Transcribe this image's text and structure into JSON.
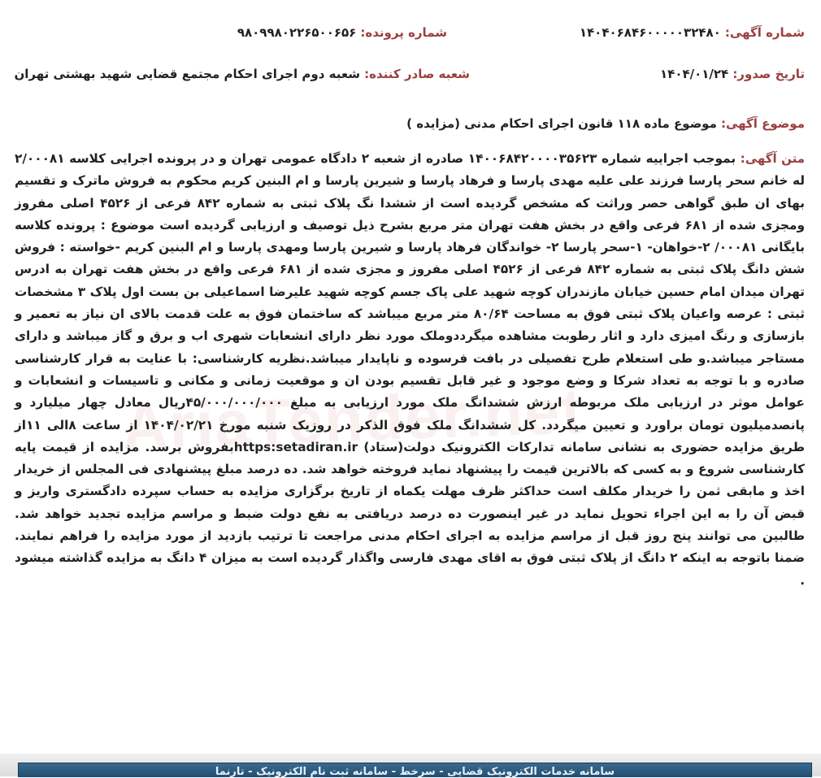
{
  "header": {
    "notice_number_label": "شماره آگهی:",
    "notice_number_value": "۱۴۰۴۰۶۸۴۶۰۰۰۰۰۳۲۴۸۰",
    "case_number_label": "شماره پرونده:",
    "case_number_value": "۹۸۰۹۹۸۰۲۲۶۵۰۰۶۵۶",
    "issue_date_label": "تاریخ صدور:",
    "issue_date_value": "۱۴۰۴/۰۱/۲۴",
    "issuer_label": "شعبه صادر کننده:",
    "issuer_value": "شعبه دوم اجرای احکام مجتمع قضایی شهید بهشتی تهران",
    "subject_label": "موضوع آگهی:",
    "subject_value": "موضوع ماده ۱۱۸ قانون اجرای احکام مدنی (مزایده )"
  },
  "body": {
    "label": "متن آگهی:",
    "text": "بموجب اجراییه شماره ۱۴۰۰۶۸۴۲۰۰۰۰۳۵۶۲۳ صادره از شعبه ۲ دادگاه عمومی تهران و در پرونده اجرایی کلاسه ۲/۰۰۰۸۱ له خانم سحر پارسا فرزند علی علیه مهدی پارسا و فرهاد پارسا و شیرین پارسا و ام البنین کریم محکوم به فروش ماترک و تقسیم بهای ان طبق گواهی حصر وراثت که مشخص گردیده است از ششدا نگ پلاک ثبتی به شماره ۸۴۲ فرعی از ۴۵۲۶ اصلی مفروز ومجزی شده از ۶۸۱ فرعی واقع در بخش هفت تهران متر مربع بشرح ذیل توصیف و ارزیابی گردیده است موضوع : پرونده کلاسه بایگانی ۰۰۰۸۱/ ۲-خواهان- ۱-سحر پارسا ۲- خواندگان فرهاد پارسا و شیرین پارسا ومهدی پارسا و ام البنین کریم -خواسته : فروش شش دانگ پلاک ثبتی به شماره ۸۴۲ فرعی از ۴۵۲۶ اصلی مفروز و مجزی شده از ۶۸۱ فرعی واقع در بخش هفت تهران به ادرس تهران میدان امام حسین خیابان مازندران کوچه شهید علی پاک جسم کوچه شهید علیرضا اسماعیلی بن بست اول پلاک ۳ مشخصات ثبتی : عرصه واعیان پلاک ثبتی فوق به مساحت ۸۰/۶۴ متر مربع میباشد که ساختمان فوق به علت قدمت بالای ان نیاز به تعمیر و بازسازی و رنگ امیزی دارد و اثار رطوبت مشاهده میگرددوملک مورد نظر دارای انشعابات شهری اب و برق و گاز میباشد و دارای مستاجر میباشد.و طی استعلام طرح تفصیلی در بافت فرسوده و ناپایدار میباشد.نظریه کارشناسی: با عنایت به قرار کارشناسی صادره و با توجه به تعداد شرکا و وضع موجود و غیر قابل تقسیم بودن ان و موقعیت زمانی و مکانی و تاسیسات و انشعابات و عوامل موثر در ارزیابی ملک مربوطه ارزش ششدانگ ملک مورد ارزیابی به مبلغ ۴۵/۰۰۰/۰۰۰/۰۰۰ریال معادل چهار میلیارد و پانصدمیلیون تومان براورد و تعیین میگردد. کل ششدانگ ملک فوق الذکر در روزیک شنبه مورخ ۱۴۰۴/۰۲/۲۱ از ساعت ۸الی ۱۱از طریق مزایده حضوری به نشانی سامانه تدارکات الکترونیک دولت(ستاد) https:setadiran.irبفروش برسد. مزایده از قیمت پایه کارشناسی شروع و به کسی که بالاترین قیمت را پیشنهاد نماید فروخته خواهد شد. ده درصد مبلغ پیشنهادی فی المجلس از خریدار اخذ و مابقی ثمن را خریدار مکلف است حداکثر ظرف مهلت یکماه از تاریخ برگزاری مزایده به حساب سپرده دادگستری واریز و قبض آن را به این اجراء تحویل نماید در غیر اینصورت ده درصد دریافتی به نفع دولت ضبط و مراسم مزایده تجدید خواهد شد. طالبین می توانند پنج روز قبل از مراسم مزایده به اجرای احکام مدنی مراجعت تا ترتیب بازدید از مورد مزایده را فراهم نمایند. ضمنا باتوجه به اینکه ۲ دانگ از پلاک ثبتی فوق به اقای مهدی فارسی واگذار گردیده است به میزان ۴ دانگ به مزایده گذاشته میشود ."
  },
  "watermark": {
    "text": "AriaTender.net"
  },
  "footer": {
    "text": "سامانه خدمات الکترونیک قضایی - سرخط - سامانه ثبت نام الکترونیک - تارنما"
  }
}
